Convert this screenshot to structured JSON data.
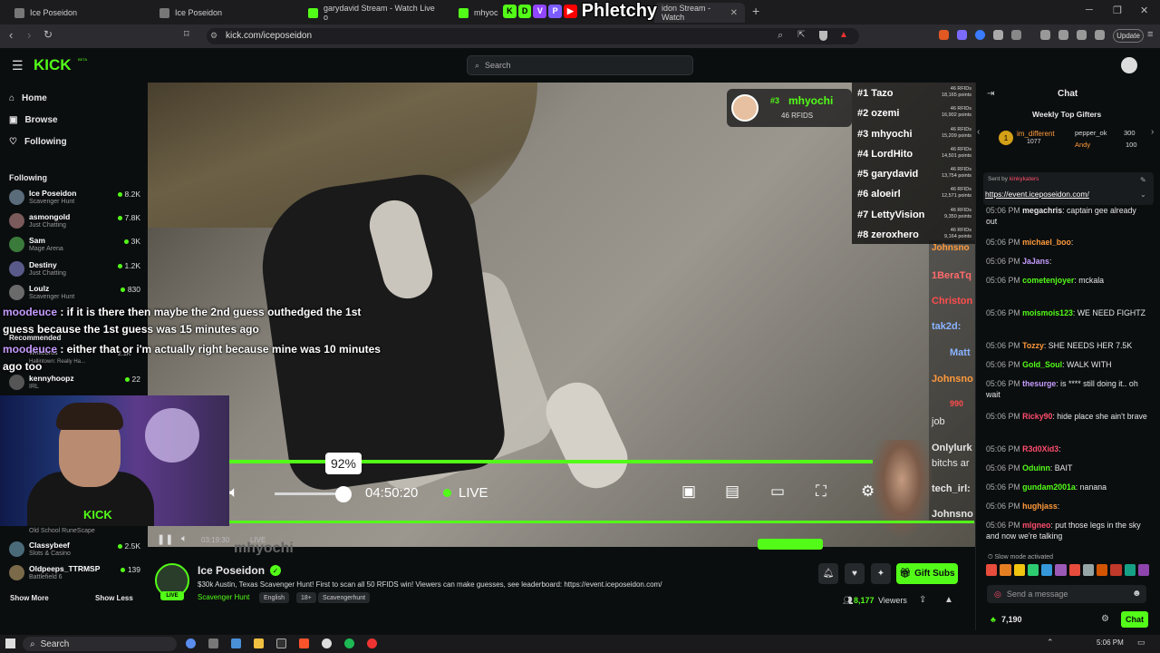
{
  "browser": {
    "tabs": [
      {
        "title": "Ice Poseidon",
        "color": "#888888"
      },
      {
        "title": "Ice Poseidon",
        "color": "#888888"
      },
      {
        "title": "garydavid Stream - Watch Live o",
        "color": "#53fc18"
      },
      {
        "title": "mhyoc",
        "color": "#53fc18"
      },
      {
        "title": "idon Stream - Watch",
        "color": "#53fc18"
      }
    ],
    "url": "kick.com/iceposeidon",
    "update_label": "Update"
  },
  "overlay_logo": {
    "text": "Phletchy",
    "badges": [
      "K",
      "D",
      "V",
      "P",
      "▶"
    ]
  },
  "header": {
    "logo": "KICK",
    "beta": "BETA",
    "search_placeholder": "Search"
  },
  "sidebar": {
    "nav": [
      {
        "icon": "home-icon",
        "glyph": "⌂",
        "label": "Home"
      },
      {
        "icon": "compass-icon",
        "glyph": "▣",
        "label": "Browse"
      },
      {
        "icon": "heart-icon",
        "glyph": "♡",
        "label": "Following"
      }
    ],
    "following_title": "Following",
    "recommended_title": "Recommended",
    "following": [
      {
        "name": "Ice Poseidon",
        "category": "Scavenger Hunt",
        "viewers": "8.2K",
        "color": "#5a6b7a"
      },
      {
        "name": "asmongold",
        "category": "Just Chatting",
        "viewers": "7.8K",
        "color": "#7a5a5a"
      },
      {
        "name": "Sam",
        "category": "Mage Arena",
        "viewers": "3K",
        "color": "#3a7a3a"
      },
      {
        "name": "Destiny",
        "category": "Just Chatting",
        "viewers": "1.2K",
        "color": "#5a5a8a"
      },
      {
        "name": "Loulz",
        "category": "Scavenger Hunt",
        "viewers": "830",
        "color": "#6a6a6a"
      }
    ],
    "partial": [
      {
        "name": "kennyhoopz",
        "category": "IRL",
        "viewers": "22"
      }
    ],
    "lower": [
      {
        "name": "Classybeef",
        "category": "Slots & Casino",
        "viewers": "2.5K",
        "color": "#4a6a7a"
      },
      {
        "name": "Oldpeeps_TTRMSP",
        "category": "Battlefield 6",
        "viewers": "139",
        "color": "#7a6a4a"
      }
    ],
    "partial_category": "Old School RuneScape",
    "partial_small": "Whitebros",
    "partial_small_cat": "Hallintown: Really Ha...",
    "partial_small_viewers": "2.1K",
    "show_more": "Show More",
    "show_less": "Show Less"
  },
  "video": {
    "overlay_messages": [
      {
        "user": "moodeuce",
        "text": " : if it is there then maybe the 2nd guess outhedged the 1st"
      },
      {
        "user": "",
        "text": "guess because the 1st guess was 15 minutes ago"
      },
      {
        "user": "moodeuce",
        "text": " : either that or i'm actually right because mine was 10 minutes"
      },
      {
        "user": "",
        "text": "ago too"
      }
    ],
    "rank_card": {
      "rank": "#3",
      "name": "mhyochi",
      "rfids": "46 RFIDS"
    },
    "leaderboard": [
      {
        "rank_name": "#1 Tazo",
        "rfids": "46 RFIDs",
        "points": "18,165 points"
      },
      {
        "rank_name": "#2 ozemi",
        "rfids": "46 RFIDs",
        "points": "16,902 points"
      },
      {
        "rank_name": "#3 mhyochi",
        "rfids": "46 RFIDs",
        "points": "15,209 points"
      },
      {
        "rank_name": "#4 LordHito",
        "rfids": "46 RFIDs",
        "points": "14,501 points"
      },
      {
        "rank_name": "#5 garydavid",
        "rfids": "46 RFIDs",
        "points": "13,754 points"
      },
      {
        "rank_name": "#6 aloeirl",
        "rfids": "46 RFIDs",
        "points": "12,571 points"
      },
      {
        "rank_name": "#7 LettyVision",
        "rfids": "46 RFIDs",
        "points": "9,350 points"
      },
      {
        "rank_name": "#8 zeroxhero",
        "rfids": "46 RFIDs",
        "points": "9,164 points"
      }
    ],
    "side_chat": [
      {
        "text": "Johnsno",
        "color": "#ff9a3c"
      },
      {
        "text": "1BeraTq",
        "color": "#ff6b6b"
      },
      {
        "text": "Christon",
        "color": "#ff4d4d"
      },
      {
        "text": "tak2d:",
        "color": "#8ab4ff"
      },
      {
        "text": "Matt",
        "color": "#8ab4ff"
      },
      {
        "text": "Johnsno",
        "color": "#ff9a3c"
      },
      {
        "text": "990",
        "color": "#ff4d4d"
      },
      {
        "text": "job",
        "color": "#e6e6e6"
      },
      {
        "text": "Onlylurk",
        "color": "#e6e6e6"
      },
      {
        "text": "bitchs ar",
        "color": "#e6e6e6"
      },
      {
        "text": "tech_irl:",
        "color": "#e6e6e6"
      },
      {
        "text": "Johnsno",
        "color": "#e6e6e6"
      }
    ],
    "volume_tooltip": "92%",
    "volume_level": 0.92,
    "time": "04:50:20",
    "live_label": "LIVE",
    "inner": {
      "time": "03:19:30",
      "live": "LIVE",
      "name": "mhyochi"
    },
    "cam_brand": "kick"
  },
  "channel": {
    "name": "Ice Poseidon",
    "title": "$30k Austin, Texas Scavenger Hunt! First to scan all 50 RFIDS win! Viewers can make guesses, see leaderboard: https://event.iceposeidon.com/",
    "category": "Scavenger Hunt",
    "tags": [
      "English",
      "18+",
      "Scavengerhunt"
    ],
    "viewers": "8,177",
    "viewers_label": "Viewers",
    "gift_label": "Gift Subs",
    "live_badge": "LIVE"
  },
  "chat": {
    "title": "Chat",
    "top_gifters_title": "Weekly Top Gifters",
    "gifters": [
      {
        "name": "im_different",
        "count": "1077"
      },
      {
        "name": "pepper_ok",
        "count": "300"
      },
      {
        "name": "Andy",
        "count": "100"
      }
    ],
    "pinned_from": "Sent by",
    "pinned_user": "kinkykaters",
    "pinned_link": "https://event.iceposeidon.com/",
    "messages": [
      {
        "time": "05:06 PM",
        "user": "megachris",
        "color": "#e6e6e6",
        "text": ": captain gee already out"
      },
      {
        "time": "05:06 PM",
        "user": "michael_boo",
        "color": "#ff9a3c",
        "text": ":"
      },
      {
        "time": "05:06 PM",
        "user": "JaJans",
        "color": "#c69cff",
        "text": ":"
      },
      {
        "time": "05:06 PM",
        "user": "cometenjoyer",
        "color": "#53fc18",
        "text": ": mckala"
      },
      {
        "time": "05:06 PM",
        "user": "moismois123",
        "color": "#53fc18",
        "text": ": WE NEED FIGHTZ"
      },
      {
        "time": "05:06 PM",
        "user": "Tozzy",
        "color": "#ff9a3c",
        "text": ": SHE NEEDS HER 7.5K"
      },
      {
        "time": "05:06 PM",
        "user": "Gold_Soul",
        "color": "#53fc18",
        "text": ": WALK WITH"
      },
      {
        "time": "05:06 PM",
        "user": "thesurge",
        "color": "#c69cff",
        "text": ": is **** still doing it.. oh wait"
      },
      {
        "time": "05:06 PM",
        "user": "Ricky90",
        "color": "#ff4d6d",
        "text": ": hide place she ain't brave"
      },
      {
        "time": "05:06 PM",
        "user": "R3d0Xid3",
        "color": "#ff4d6d",
        "text": ":"
      },
      {
        "time": "05:06 PM",
        "user": "Oduinn",
        "color": "#53fc18",
        "text": ": BAIT"
      },
      {
        "time": "05:06 PM",
        "user": "gundam2001a",
        "color": "#53fc18",
        "text": ": nanana"
      },
      {
        "time": "05:06 PM",
        "user": "hughjass",
        "color": "#ff9a3c",
        "text": ":"
      },
      {
        "time": "05:06 PM",
        "user": "mlgneo",
        "color": "#ff4d6d",
        "text": ": put those legs in the sky and now we're talking"
      }
    ],
    "slow_mode": "Slow mode activated",
    "input_placeholder": "Send a message",
    "points": "7,190",
    "chat_button": "Chat"
  },
  "taskbar": {
    "search": "Search",
    "time": "5:06 PM"
  }
}
